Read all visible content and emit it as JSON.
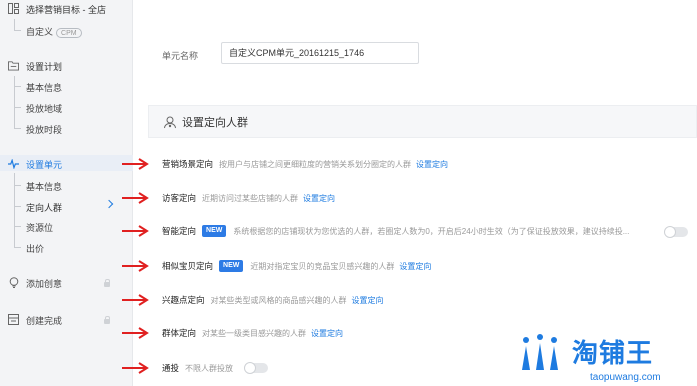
{
  "sidebar": {
    "step1_label": "选择营销目标 - 全店",
    "step1_sub": "自定义",
    "cpm_badge": "CPM",
    "step2_label": "设置计划",
    "step2_items": [
      "基本信息",
      "投放地域",
      "投放时段"
    ],
    "step3_label": "设置单元",
    "step3_items": [
      "基本信息",
      "定向人群",
      "资源位",
      "出价"
    ],
    "step4_label": "添加创意",
    "step5_label": "创建完成"
  },
  "main": {
    "unit_name_label": "单元名称",
    "unit_name_value": "自定义CPM单元_20161215_1746",
    "section_title": "设置定向人群",
    "new_badge": "NEW",
    "link_label": "设置定向",
    "rows": [
      {
        "name": "营销场景定向",
        "desc": "按用户与店铺之间更细粒度的营销关系划分圈定的人群"
      },
      {
        "name": "访客定向",
        "desc": "近期访问过某些店铺的人群"
      },
      {
        "name": "智能定向",
        "desc": "系统根据您的店铺现状为您优选的人群，若圈定人数为0，开启后24小时生效（为了保证投放效果，建议持续投..."
      },
      {
        "name": "相似宝贝定向",
        "desc": "近期对指定宝贝的竞品宝贝感兴趣的人群"
      },
      {
        "name": "兴趣点定向",
        "desc": "对某些类型或风格的商品感兴趣的人群"
      },
      {
        "name": "群体定向",
        "desc": "对某些一级类目感兴趣的人群"
      },
      {
        "name": "通投",
        "desc": "不限人群投放"
      }
    ]
  },
  "watermark": {
    "logo": "淘铺王",
    "url": "taopuwang.com"
  },
  "colors": {
    "accent": "#1e7be0",
    "arrow": "#e02020",
    "badge": "#2d7be5"
  }
}
